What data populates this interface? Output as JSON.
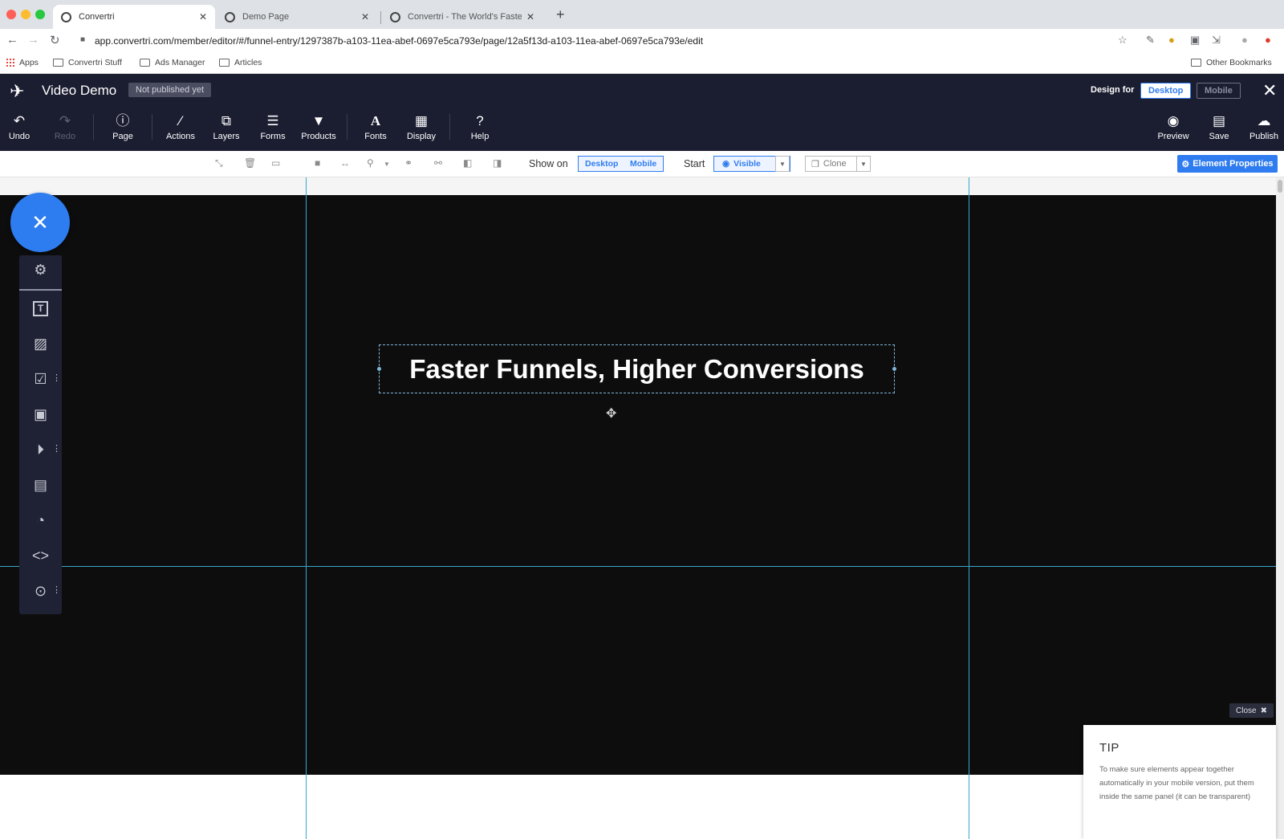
{
  "browser": {
    "tabs": [
      {
        "title": "Convertri",
        "active": true
      },
      {
        "title": "Demo Page",
        "active": false
      },
      {
        "title": "Convertri - The World's Fastes",
        "active": false
      }
    ],
    "url": "app.convertri.com/member/editor/#/funnel-entry/1297387b-a103-11ea-abef-0697e5ca793e/page/12a5f13d-a103-11ea-abef-0697e5ca793e/edit",
    "bookmarks": [
      "Apps",
      "Convertri Stuff",
      "Ads Manager",
      "Articles"
    ],
    "other_bookmarks": "Other Bookmarks"
  },
  "editor": {
    "title": "Video Demo",
    "status_badge": "Not published yet",
    "design_for_label": "Design for",
    "design_for_options": [
      "Desktop",
      "Mobile"
    ],
    "toolbar": [
      {
        "label": "Undo",
        "icon": "undo-icon"
      },
      {
        "label": "Redo",
        "icon": "redo-icon"
      },
      {
        "label": "Page",
        "icon": "info-icon"
      },
      {
        "label": "Actions",
        "icon": "wand-icon"
      },
      {
        "label": "Layers",
        "icon": "layers-icon"
      },
      {
        "label": "Forms",
        "icon": "list-icon"
      },
      {
        "label": "Products",
        "icon": "cart-icon"
      },
      {
        "label": "Fonts",
        "icon": "font-icon"
      },
      {
        "label": "Display",
        "icon": "grid-icon"
      },
      {
        "label": "Help",
        "icon": "question-icon"
      },
      {
        "label": "Preview",
        "icon": "eye-icon"
      },
      {
        "label": "Save",
        "icon": "save-icon"
      },
      {
        "label": "Publish",
        "icon": "cloud-upload-icon"
      }
    ]
  },
  "element_toolbar": {
    "show_on_label": "Show on",
    "show_on_options": [
      "Desktop",
      "Mobile"
    ],
    "start_label": "Start",
    "start_value": "Visible",
    "clone_label": "Clone",
    "properties_label": "Element Properties"
  },
  "canvas": {
    "headline": "Faster Funnels, Higher Conversions"
  },
  "tip": {
    "close_label": "Close",
    "title": "TIP",
    "text": "To make sure elements appear together automatically in your mobile version, put them inside the same panel (it can be transparent)"
  },
  "colors": {
    "editor_header": "#1b1d31",
    "accent": "#2f7cf0",
    "canvas_section": "#0e0d0e",
    "guide": "#37a9c9"
  }
}
